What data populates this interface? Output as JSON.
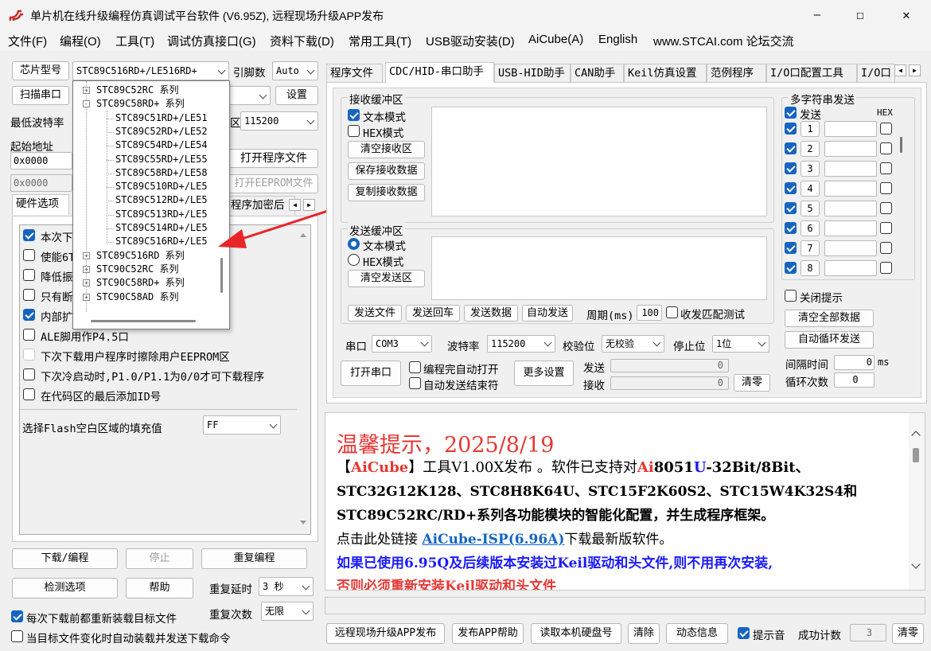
{
  "window": {
    "title": "单片机在线升级编程仿真调试平台软件 (V6.95Z), 远程现场升级APP发布",
    "min": "—",
    "max": "☐",
    "close": "✕"
  },
  "menu": [
    "文件(F)",
    "编程(O)",
    "工具(T)",
    "调试仿真接口(G)",
    "资料下载(D)",
    "常用工具(T)",
    "USB驱动安装(D)",
    "AiCube(A)",
    "English",
    "www.STCAI.com 论坛交流"
  ],
  "left": {
    "chip_btn": "芯片型号",
    "chip_value": "STC89C516RD+/LE516RD+",
    "pin_label": "引脚数",
    "pin_value": "Auto",
    "scan_btn": "扫描串口",
    "set_btn": "设置",
    "baud_label": "最低波特率",
    "baud_value": "115200",
    "baud_suffix": "区",
    "start_addr_label": "起始地址",
    "addr1": "0x0000",
    "addr2": "0x0000",
    "open_prog": "打开程序文件",
    "open_eeprom": "打开EEPROM文件",
    "tab_hw": "硬件选项",
    "tab_encrypt": "程序加密后",
    "options": [
      {
        "text": "本次下",
        "checked": true
      },
      {
        "text": "使能6T",
        "checked": false
      },
      {
        "text": "降低振",
        "checked": false
      },
      {
        "text": "只有断",
        "checked": false
      },
      {
        "text": "内部扩",
        "checked": true
      },
      {
        "text": "ALE脚用作P4.5口",
        "checked": false
      },
      {
        "text": "下次下载用户程序时擦除用户EEPROM区",
        "checked": false
      },
      {
        "text": "下次冷启动时,P1.0/P1.1为0/0才可下载程序",
        "checked": false
      },
      {
        "text": "在代码区的最后添加ID号",
        "checked": false
      }
    ],
    "fill_label": "选择Flash空白区域的填充值",
    "fill_value": "FF",
    "download": "下载/编程",
    "stop": "停止",
    "reprog": "重复编程",
    "detect": "检测选项",
    "help": "帮助",
    "delay_label": "重复延时",
    "delay_value": "3 秒",
    "count_label": "重复次数",
    "count_value": "无限",
    "reload_each": "每次下载前都重新装载目标文件",
    "reload_change": "当目标文件变化时自动装载并发送下载命令"
  },
  "dropdown": [
    {
      "text": "STC89C52RC 系列",
      "level": 0,
      "exp": "+"
    },
    {
      "text": "STC89C58RD+ 系列",
      "level": 0,
      "exp": "-"
    },
    {
      "text": "STC89C51RD+/LE51",
      "level": 1
    },
    {
      "text": "STC89C52RD+/LE52",
      "level": 1
    },
    {
      "text": "STC89C54RD+/LE54",
      "level": 1
    },
    {
      "text": "STC89C55RD+/LE55",
      "level": 1
    },
    {
      "text": "STC89C58RD+/LE58",
      "level": 1
    },
    {
      "text": "STC89C510RD+/LE5",
      "level": 1
    },
    {
      "text": "STC89C512RD+/LE5",
      "level": 1
    },
    {
      "text": "STC89C513RD+/LE5",
      "level": 1
    },
    {
      "text": "STC89C514RD+/LE5",
      "level": 1
    },
    {
      "text": "STC89C516RD+/LE5",
      "level": 1
    },
    {
      "text": "STC89C516RD 系列",
      "level": 0,
      "exp": "+"
    },
    {
      "text": "STC90C52RC 系列",
      "level": 0,
      "exp": "+"
    },
    {
      "text": "STC90C58RD+ 系列",
      "level": 0,
      "exp": "+"
    },
    {
      "text": "STC90C58AD 系列",
      "level": 0,
      "exp": "+"
    }
  ],
  "tabs": [
    "程序文件",
    "CDC/HID-串口助手",
    "USB-HID助手",
    "CAN助手",
    "Keil仿真设置",
    "范例程序",
    "I/O口配置工具",
    "I/O口"
  ],
  "serial": {
    "recv_title": "接收缓冲区",
    "text_mode": "文本模式",
    "hex_mode": "HEX模式",
    "clear_recv": "清空接收区",
    "save_recv": "保存接收数据",
    "copy_recv": "复制接收数据",
    "send_title": "发送缓冲区",
    "clear_send": "清空发送区",
    "send_file": "发送文件",
    "send_enter": "发送回车",
    "send_data": "发送数据",
    "auto_send": "自动发送",
    "period_label": "周期(ms)",
    "period_value": "100",
    "match_test": "收发匹配测试",
    "port_label": "串口",
    "port_value": "COM3",
    "baud_label": "波特率",
    "baud_value": "115200",
    "parity_label": "校验位",
    "parity_value": "无校验",
    "stop_label": "停止位",
    "stop_value": "1位",
    "open_port": "打开串口",
    "auto_open": "编程完自动打开",
    "auto_close": "自动发送结束符",
    "more": "更多设置",
    "send_label": "发送",
    "send_count": "0",
    "recv_label": "接收",
    "recv_count": "0",
    "clear": "清零"
  },
  "multi": {
    "title": "多字符串发送",
    "send": "发送",
    "hex": "HEX",
    "rows": [
      "1",
      "2",
      "3",
      "4",
      "5",
      "6",
      "7",
      "8"
    ],
    "close_tip": "关闭提示",
    "clear_all": "清空全部数据",
    "auto_loop": "自动循环发送",
    "interval_label": "间隔时间",
    "interval_value": "0",
    "interval_unit": "ms",
    "loop_label": "循环次数",
    "loop_value": "0"
  },
  "news": {
    "title": "温馨提示，2025/8/19",
    "l1a": "【",
    "l1b": "AiCube",
    "l1c": "】工具V1.00X发布 。软件已支持对",
    "l1d": "Ai",
    "l1e": "8051",
    "l1f": "U",
    "l1g": "-32Bit/8Bit、",
    "l2": "STC32G12K128、STC8H8K64U、STC15F2K60S2、STC15W4K32S4和",
    "l3": "STC89C52RC/RD+系列各功能模块的智能化配置，并生成程序框架。",
    "l4a": "点击此处链接 ",
    "l4b": "AiCube-ISP(6.96A)",
    "l4c": "下载最新版软件。",
    "l5": "如果已使用6.95Q及后续版本安装过Keil驱动和头文件,则不用再次安装,",
    "l6": "否则必须重新安装Keil驱动和头文件"
  },
  "bottom": {
    "remote": "远程现场升级APP发布",
    "app_help": "发布APP帮助",
    "read_disk": "读取本机硬盘号",
    "clear": "清除",
    "dynamic": "动态信息",
    "sound": "提示音",
    "success_label": "成功计数",
    "success_value": "3",
    "zero": "清零"
  },
  "colors": {
    "accent": "#1565c0",
    "arrow": "#e8262a",
    "news_red": "#e53935",
    "news_blue": "#1a1aff"
  }
}
